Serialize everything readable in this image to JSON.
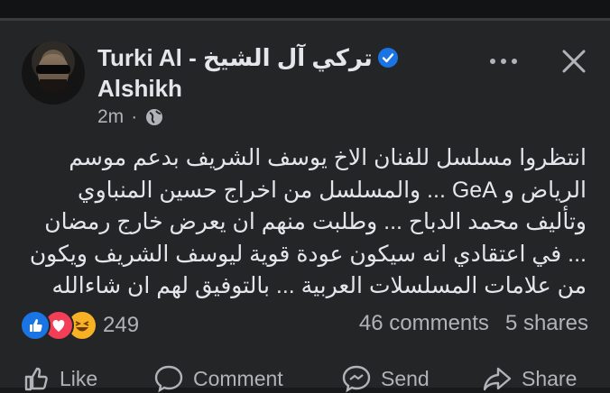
{
  "post": {
    "author_latin": "Turki Al - ",
    "author_arabic": "تركي آل الشيخ",
    "author_line2": "Alshikh",
    "time": "2m",
    "separator": "·",
    "body_lines": [
      "انتظروا مسلسل للفنان الاخ يوسف الشريف بدعم موسم",
      "الرياض و GeA ... والمسلسل من اخراج حسين المنباوي",
      "وتأليف محمد الدباح ... وطلبت منهم ان يعرض خارج رمضان",
      "... في اعتقادي انه سيكون عودة قوية ليوسف الشريف ويكون",
      "من علامات المسلسلات العربية ... بالتوفيق لهم ان شاءالله"
    ]
  },
  "engagement": {
    "reaction_count": "249",
    "comments": "46 comments",
    "shares": "5 shares"
  },
  "actions": {
    "like": "Like",
    "comment": "Comment",
    "send": "Send",
    "share": "Share"
  },
  "colors": {
    "background": "#242526",
    "accent": "#1b74e4",
    "love": "#f33e58",
    "haha": "#f7b125"
  },
  "icons": [
    "verified-icon",
    "more-icon",
    "close-icon",
    "globe-icon",
    "like-reaction-icon",
    "love-reaction-icon",
    "haha-reaction-icon",
    "like-icon",
    "comment-icon",
    "send-icon",
    "share-icon"
  ]
}
